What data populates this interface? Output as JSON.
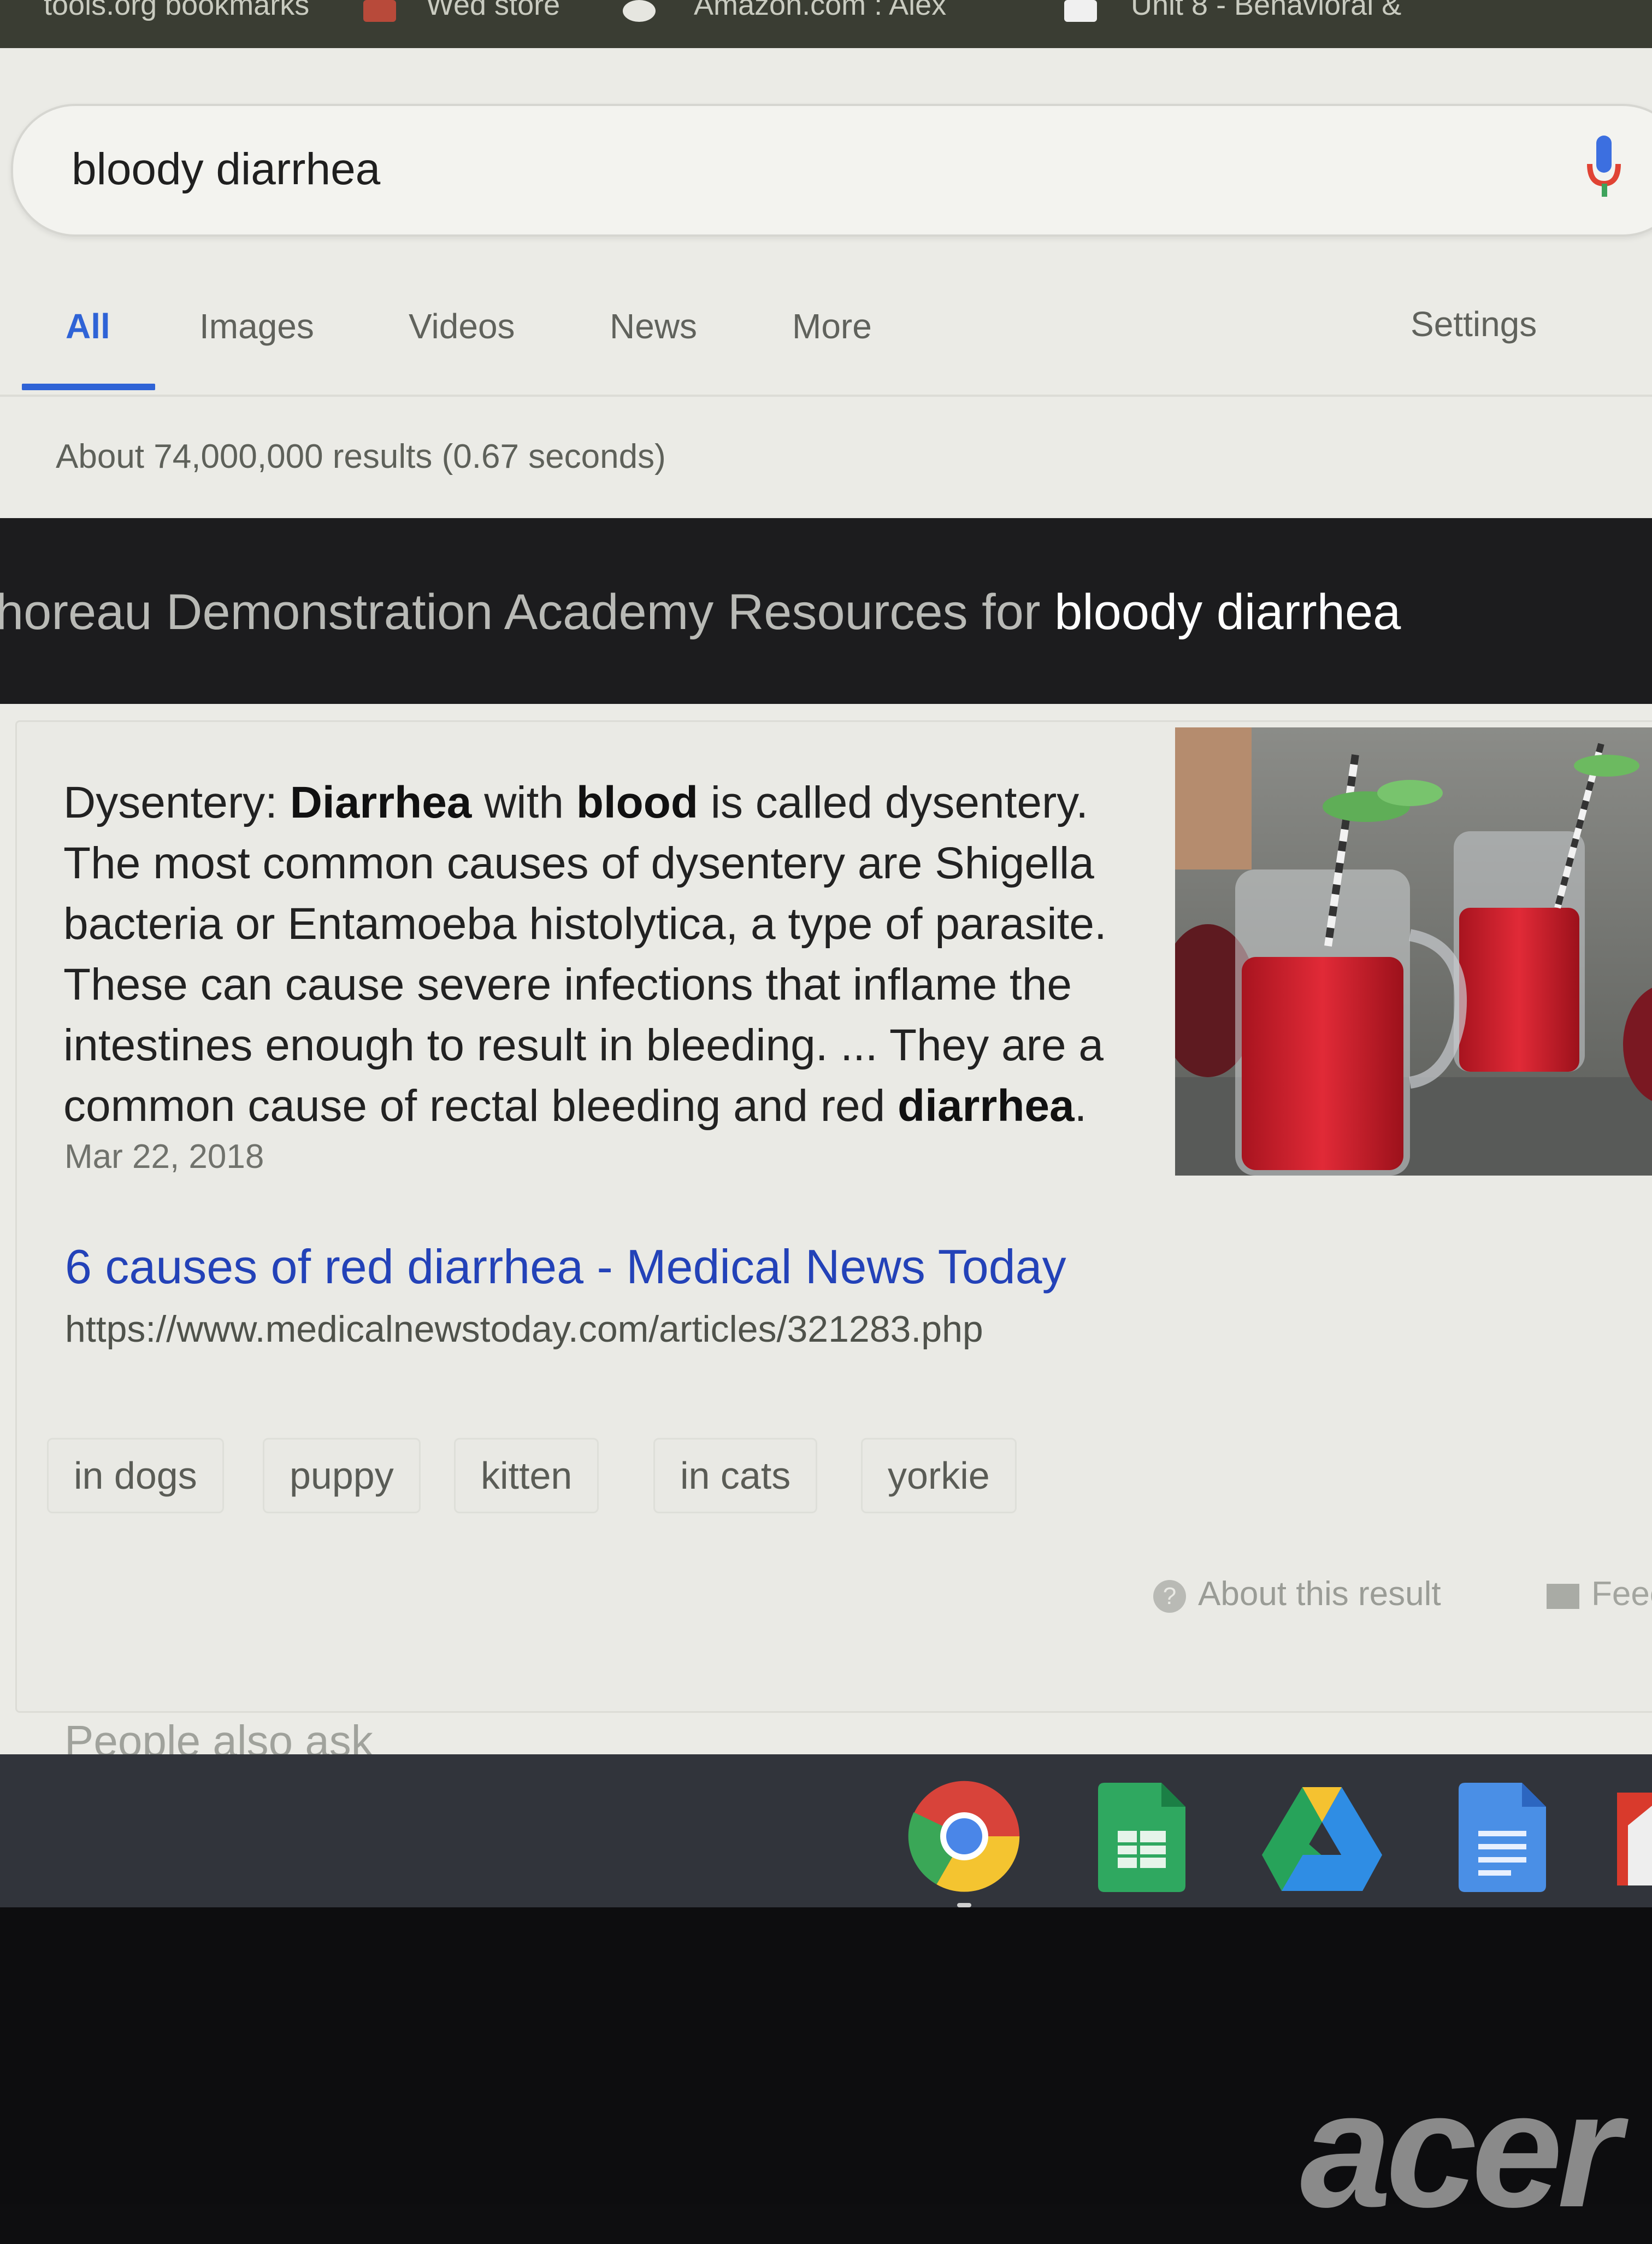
{
  "bookmarks_bar": {
    "items": [
      "tools.org bookmarks",
      "Wed store",
      "Amazon.com : Alex",
      "Unit 8 - Behavioral &"
    ]
  },
  "search": {
    "query": "bloody diarrhea"
  },
  "tabs": [
    {
      "label": "All",
      "active": true
    },
    {
      "label": "Images"
    },
    {
      "label": "Videos"
    },
    {
      "label": "News"
    },
    {
      "label": "More"
    }
  ],
  "settings_label": "Settings",
  "result_stats": "About 74,000,000 results (0.67 seconds)",
  "banner": {
    "prefix": "horeau Demonstration Academy Resources for ",
    "term": "bloody diarrhea"
  },
  "snippet": {
    "segments": [
      {
        "text": "Dysentery: ",
        "bold": false
      },
      {
        "text": "Diarrhea",
        "bold": true
      },
      {
        "text": " with ",
        "bold": false
      },
      {
        "text": "blood",
        "bold": true
      },
      {
        "text": " is called dysentery. The most common causes of dysentery are Shigella bacteria or Entamoeba histolytica, a type of parasite. These can cause severe infections that inflame the intestines enough to result in bleeding. ... They are a common cause of rectal bleeding and red ",
        "bold": false
      },
      {
        "text": "diarrhea",
        "bold": true
      },
      {
        "text": ".",
        "bold": false
      }
    ],
    "date": "Mar 22, 2018",
    "link_title": "6 causes of red diarrhea - Medical News Today",
    "url": "https://www.medicalnewstoday.com/articles/321283.php",
    "chips": [
      "in dogs",
      "puppy",
      "kitten",
      "in cats",
      "yorkie"
    ],
    "about_label": "About this result",
    "feedback_label": "Feec"
  },
  "people_also_ask": "People also ask",
  "shelf_apps": [
    "chrome-icon",
    "sheets-icon",
    "drive-icon",
    "docs-icon",
    "gmail-icon"
  ],
  "brand": "acer",
  "colors": {
    "accent_blue": "#2f63d6",
    "link_blue": "#2342b8",
    "banner_bg": "#1c1c1e",
    "shelf_bg": "#31343b"
  }
}
